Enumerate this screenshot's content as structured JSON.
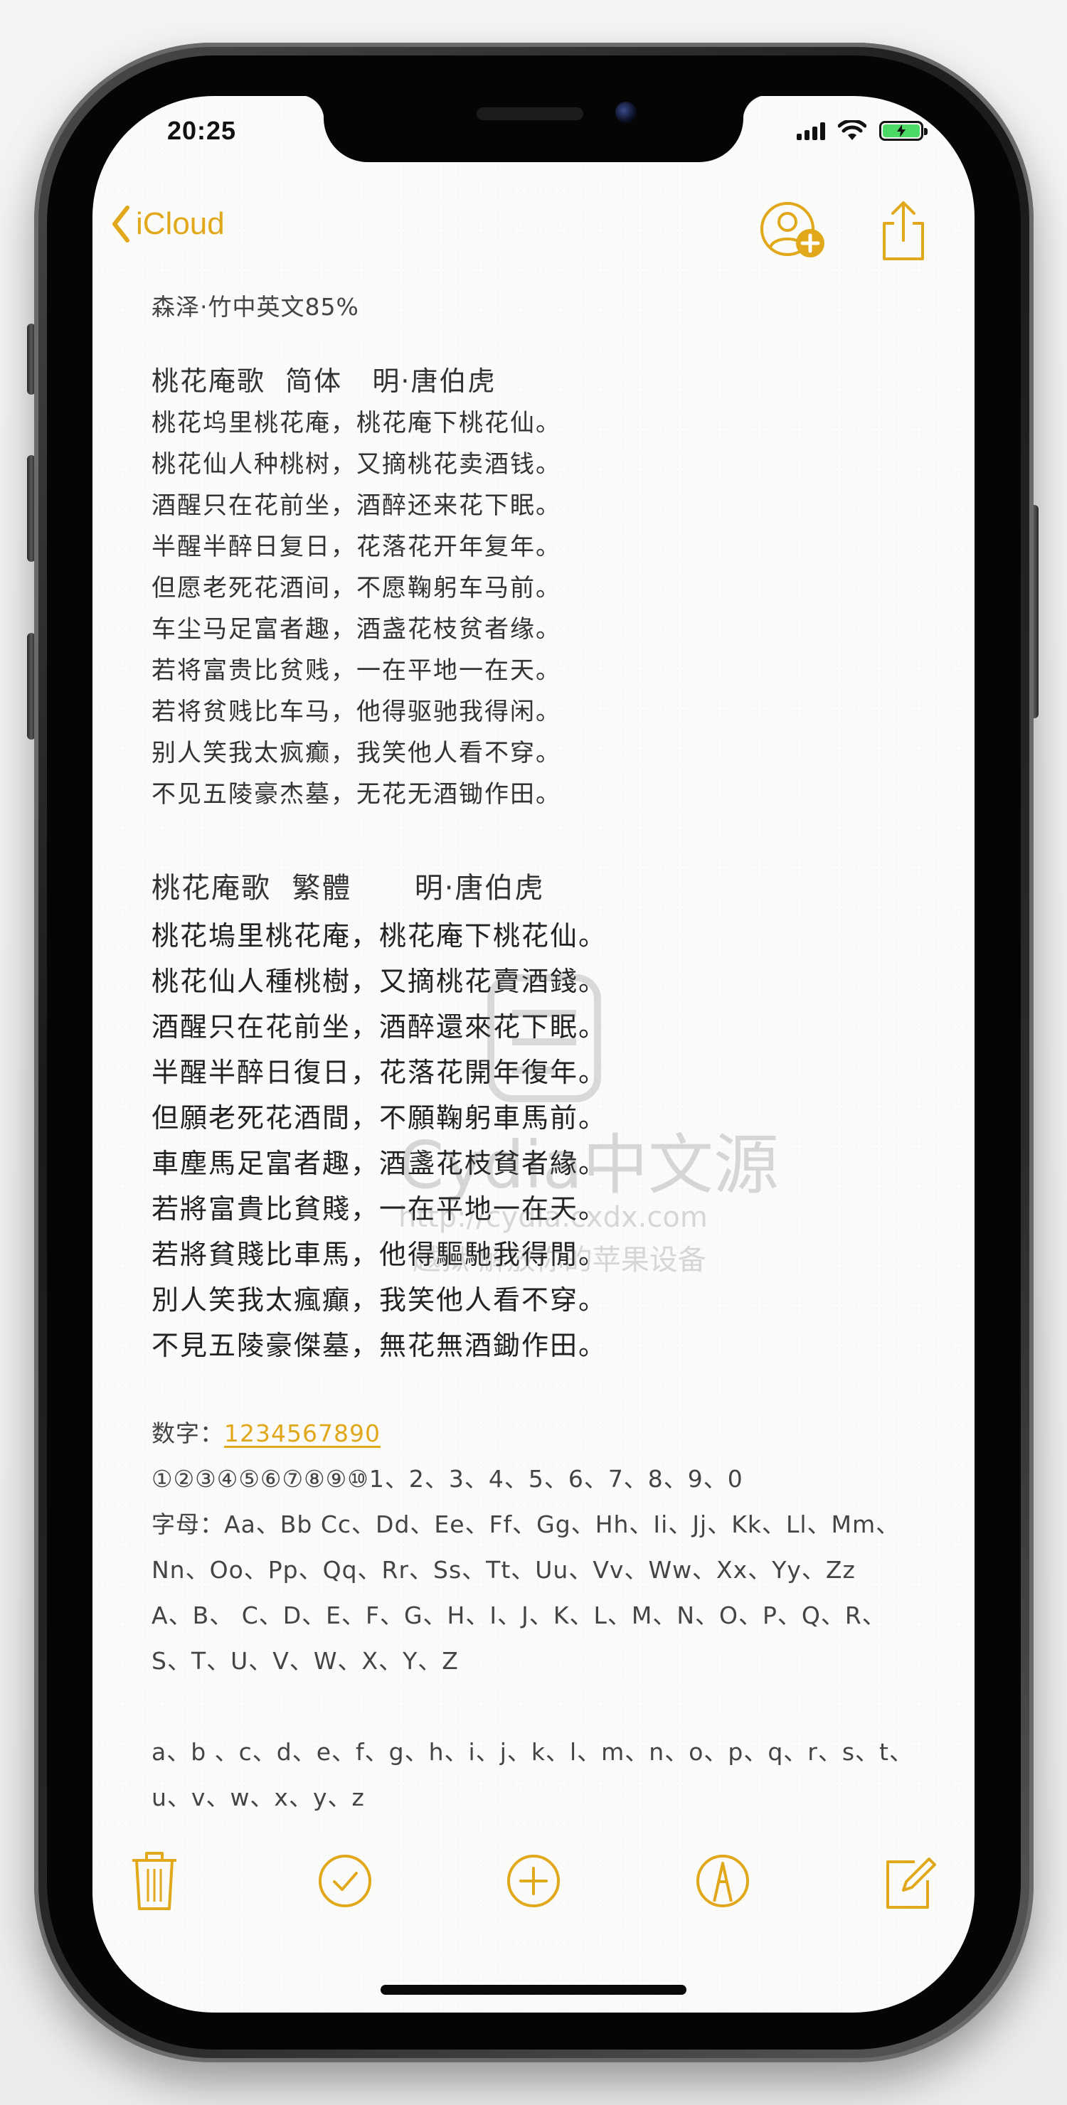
{
  "status_bar": {
    "time": "20:25"
  },
  "nav": {
    "back_label": "iCloud",
    "icons": [
      "back-chevron-icon",
      "add-person-icon",
      "share-icon"
    ]
  },
  "note": {
    "title": "森泽·竹中英文85%",
    "poem_simplified": {
      "heading": "桃花庵歌  简体   明·唐伯虎",
      "lines": [
        "桃花坞里桃花庵，桃花庵下桃花仙。",
        "桃花仙人种桃树，又摘桃花卖酒钱。",
        "酒醒只在花前坐，酒醉还来花下眠。",
        "半醒半醉日复日，花落花开年复年。",
        "但愿老死花酒间，不愿鞠躬车马前。",
        "车尘马足富者趣，酒盏花枝贫者缘。",
        "若将富贵比贫贱，一在平地一在天。",
        "若将贫贱比车马，他得驱驰我得闲。",
        "别人笑我太疯癫，我笑他人看不穿。",
        "不见五陵豪杰墓，无花无酒锄作田。"
      ]
    },
    "poem_traditional": {
      "heading": "桃花庵歌  繁體      明·唐伯虎",
      "lines": [
        "桃花塢里桃花庵，桃花庵下桃花仙。",
        "桃花仙人種桃樹，又摘桃花賣酒錢。",
        "酒醒只在花前坐，酒醉還來花下眠。",
        "半醒半醉日復日，花落花開年復年。",
        "但願老死花酒間，不願鞠躬車馬前。",
        "車塵馬足富者趣，酒盞花枝貧者緣。",
        "若將富貴比貧賤，一在平地一在天。",
        "若將貧賤比車馬，他得驅馳我得閒。",
        "別人笑我太瘋癲，我笑他人看不穿。",
        "不見五陵豪傑墓，無花無酒鋤作田。"
      ]
    },
    "numbers_label": "数字：",
    "numbers_link": "1234567890",
    "circled_line": "①②③④⑤⑥⑦⑧⑨⑩1、2、3、4、5、6、7、8、9、0",
    "letters_label": "字母：",
    "letters_line1": "Aa、Bb Cc、Dd、Ee、Ff、Gg、Hh、Ii、Jj、Kk、Ll、Mm、",
    "letters_line2": "Nn、Oo、Pp、Qq、Rr、Ss、Tt、Uu、Vv、Ww、Xx、Yy、Zz",
    "upper_line1": "A、B、 C、D、E、F、G、H、I、J、K、L、M、N、O、P、Q、R、",
    "upper_line2": "S、T、U、V、W、X、Y、Z",
    "lower_line1": "a、b 、c、d、e、f、g、h、i、j、k、l、m、n、o、p、q、r、s、t、",
    "lower_line2": "u、v、w、x、y、z"
  },
  "watermark": {
    "title": "Cydia中文源",
    "url": "http://cydia.cxdx.com",
    "tagline": "越狱 解放你的苹果设备"
  },
  "toolbar": {
    "icons": [
      "trash-icon",
      "checklist-icon",
      "add-icon",
      "markup-icon",
      "compose-icon"
    ]
  },
  "colors": {
    "accent": "#e0a81a",
    "text": "#333333",
    "battery": "#4cd964"
  }
}
